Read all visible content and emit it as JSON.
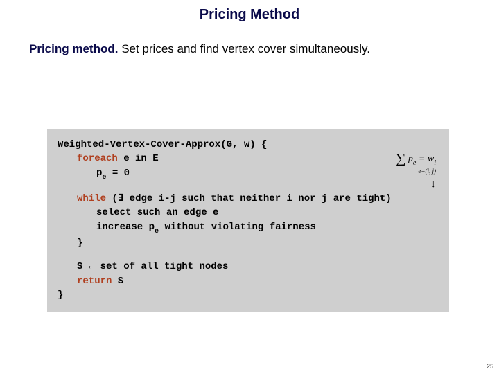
{
  "title": "Pricing Method",
  "intro": {
    "lead": "Pricing method.",
    "rest": "  Set prices and find vertex cover simultaneously."
  },
  "code": {
    "line1_pre": "Weighted-Vertex-Cover-Approx(G, w) {",
    "foreach_kw": "foreach",
    "foreach_rest": " e in E",
    "init_pe_pre": "p",
    "init_pe_sub": "e",
    "init_pe_post": " = 0",
    "while_kw": "while",
    "while_open": " (",
    "exists": "∃",
    "while_cond": " edge i-j such that neither i nor j are tight)",
    "select_line": "select such an edge e",
    "increase_pre": "increase p",
    "increase_sub": "e",
    "increase_post": " without violating fairness",
    "brace_close_inner": "}",
    "s_assign_pre": "S ",
    "leftarrow": "←",
    "s_assign_post": " set of all tight nodes",
    "return_kw": "return",
    "return_rest": " S",
    "brace_close_outer": "}"
  },
  "formula": {
    "sigma": "∑",
    "subscript": "e=(i, j)",
    "body_p": "p",
    "body_e": "e",
    "body_eq": " = w",
    "body_i": "i",
    "arrow": "↓"
  },
  "page_number": "25"
}
